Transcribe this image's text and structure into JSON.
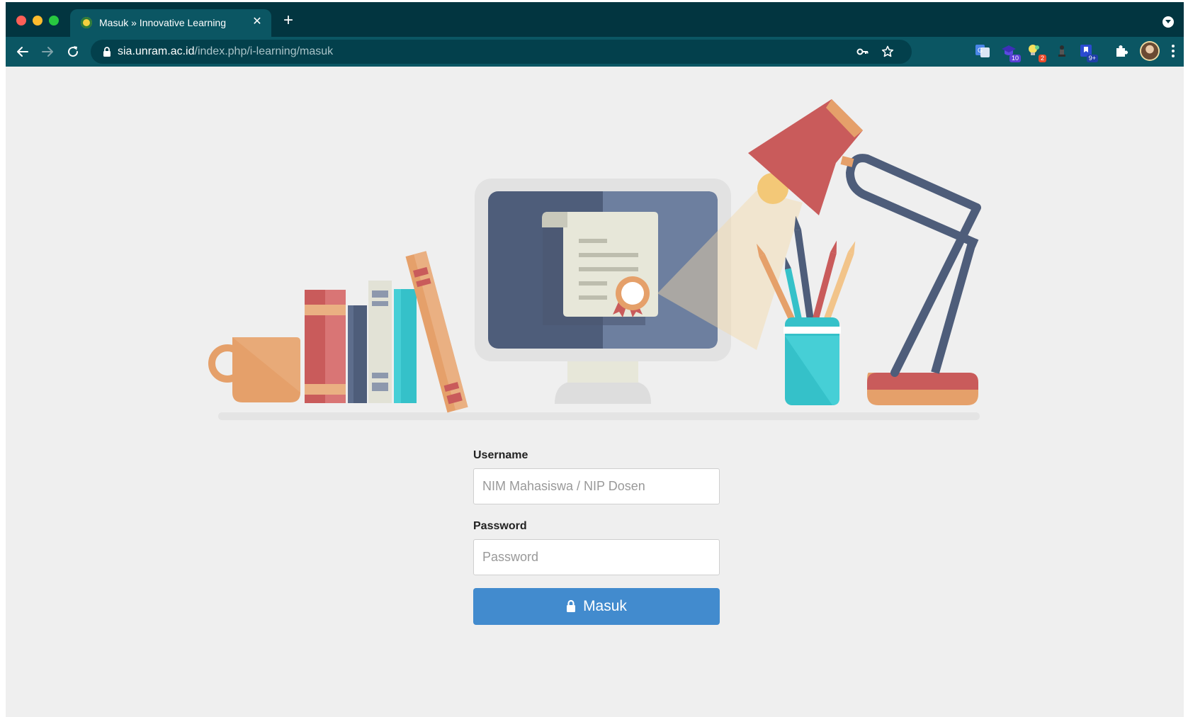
{
  "browser": {
    "tab": {
      "title": "Masuk » Innovative Learning"
    },
    "address": {
      "host": "sia.unram.ac.id",
      "path": "/index.php/i-learning/masuk"
    },
    "extensions": [
      {
        "name": "google-translate-icon",
        "badge": ""
      },
      {
        "name": "graduation-cap-icon",
        "badge": "10",
        "badge_color": "#5b3fd6"
      },
      {
        "name": "lightbulb-icon",
        "badge": "2",
        "badge_color": "#e8492a"
      },
      {
        "name": "chess-piece-icon",
        "badge": ""
      },
      {
        "name": "bookmark-icon",
        "badge": "9+",
        "badge_color": "#1f3fa8"
      }
    ]
  },
  "login": {
    "username": {
      "label": "Username",
      "placeholder": "NIM Mahasiswa / NIP Dosen",
      "value": ""
    },
    "password": {
      "label": "Password",
      "placeholder": "Password",
      "value": ""
    },
    "submit": {
      "label": "Masuk"
    }
  },
  "colors": {
    "chrome_dark": "#023540",
    "chrome": "#0b5663",
    "page_bg": "#efefef",
    "primary": "#428bce"
  }
}
